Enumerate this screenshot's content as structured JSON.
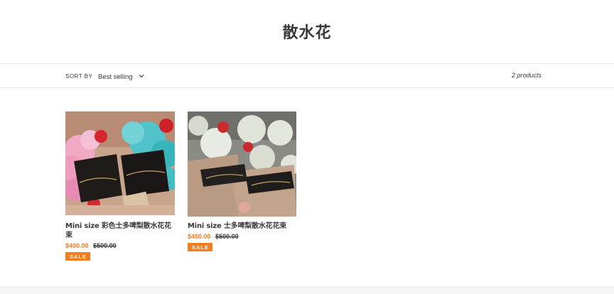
{
  "collection": {
    "title": "散水花"
  },
  "filters": {
    "sort_label": "SORT BY",
    "sort_value": "Best selling",
    "product_count": "2 products"
  },
  "products": [
    {
      "title": "Mini size 彩色士多啤梨散水花花束",
      "sale_price": "$400.00",
      "regular_price": "$500.00",
      "badge": "SALE",
      "image_icon": "product-photo-bouquet-colorful"
    },
    {
      "title": "Mini size 士多啤梨散水花花束",
      "sale_price": "$450.00",
      "regular_price": "$500.00",
      "badge": "SALE",
      "image_icon": "product-photo-bouquet-white"
    }
  ],
  "colors": {
    "accent": "#f07d1e",
    "text": "#3a3a3a",
    "border": "#ebebeb"
  }
}
